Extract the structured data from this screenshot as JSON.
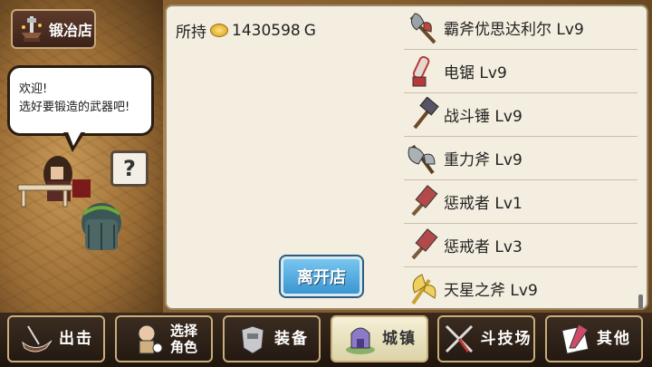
{
  "shop_tag": {
    "icon": "anvil-icon",
    "label": "锻冶店"
  },
  "speech": {
    "line1": "欢迎!",
    "line2": "选好要锻造的武器吧!"
  },
  "help_button": {
    "label": "?"
  },
  "gold": {
    "prefix": "所持",
    "amount": "1430598",
    "unit": "G"
  },
  "leave_button": {
    "label": "离开店"
  },
  "weapons": [
    {
      "icon": "battle-axe-icon",
      "name": "霸斧优思达利尔",
      "level": "Lv9"
    },
    {
      "icon": "chainsaw-icon",
      "name": "电锯",
      "level": "Lv9"
    },
    {
      "icon": "war-hammer-icon",
      "name": "战斗锤",
      "level": "Lv9"
    },
    {
      "icon": "gravity-axe-icon",
      "name": "重力斧",
      "level": "Lv9"
    },
    {
      "icon": "punisher-hammer-icon",
      "name": "惩戒者",
      "level": "Lv1"
    },
    {
      "icon": "punisher-hammer-icon",
      "name": "惩戒者",
      "level": "Lv3"
    },
    {
      "icon": "star-axe-icon",
      "name": "天星之斧",
      "level": "Lv9"
    }
  ],
  "nav": [
    {
      "icon": "sortie-icon",
      "label": "出击",
      "active": false
    },
    {
      "icon": "character-select-icon",
      "label1": "选择",
      "label2": "角色",
      "active": false
    },
    {
      "icon": "equipment-icon",
      "label": "装备",
      "active": false
    },
    {
      "icon": "town-icon",
      "label": "城镇",
      "active": true
    },
    {
      "icon": "arena-icon",
      "label": "斗技场",
      "active": false
    },
    {
      "icon": "other-icon",
      "label": "其他",
      "active": false
    }
  ],
  "colors": {
    "panel_bg": "#f3eedf",
    "leave_button": "#3a95d0",
    "nav_border": "#c9ad7a",
    "active_tab": "#f5f0d8"
  }
}
